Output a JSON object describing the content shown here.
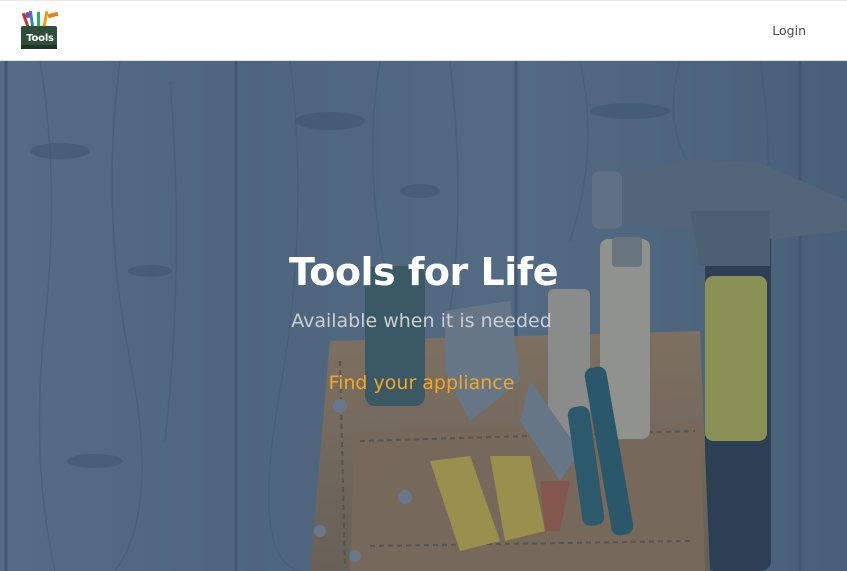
{
  "header": {
    "logo_text": "Tools",
    "login_label": "Login"
  },
  "hero": {
    "title": "Tools for Life",
    "subtitle": "Available when it is needed",
    "cta_label": "Find your appliance"
  },
  "colors": {
    "accent": "#f5a623",
    "overlay": "#3b5775",
    "hammer_handle": "#d9d334"
  },
  "icons": [
    "toolbox-logo-icon"
  ]
}
